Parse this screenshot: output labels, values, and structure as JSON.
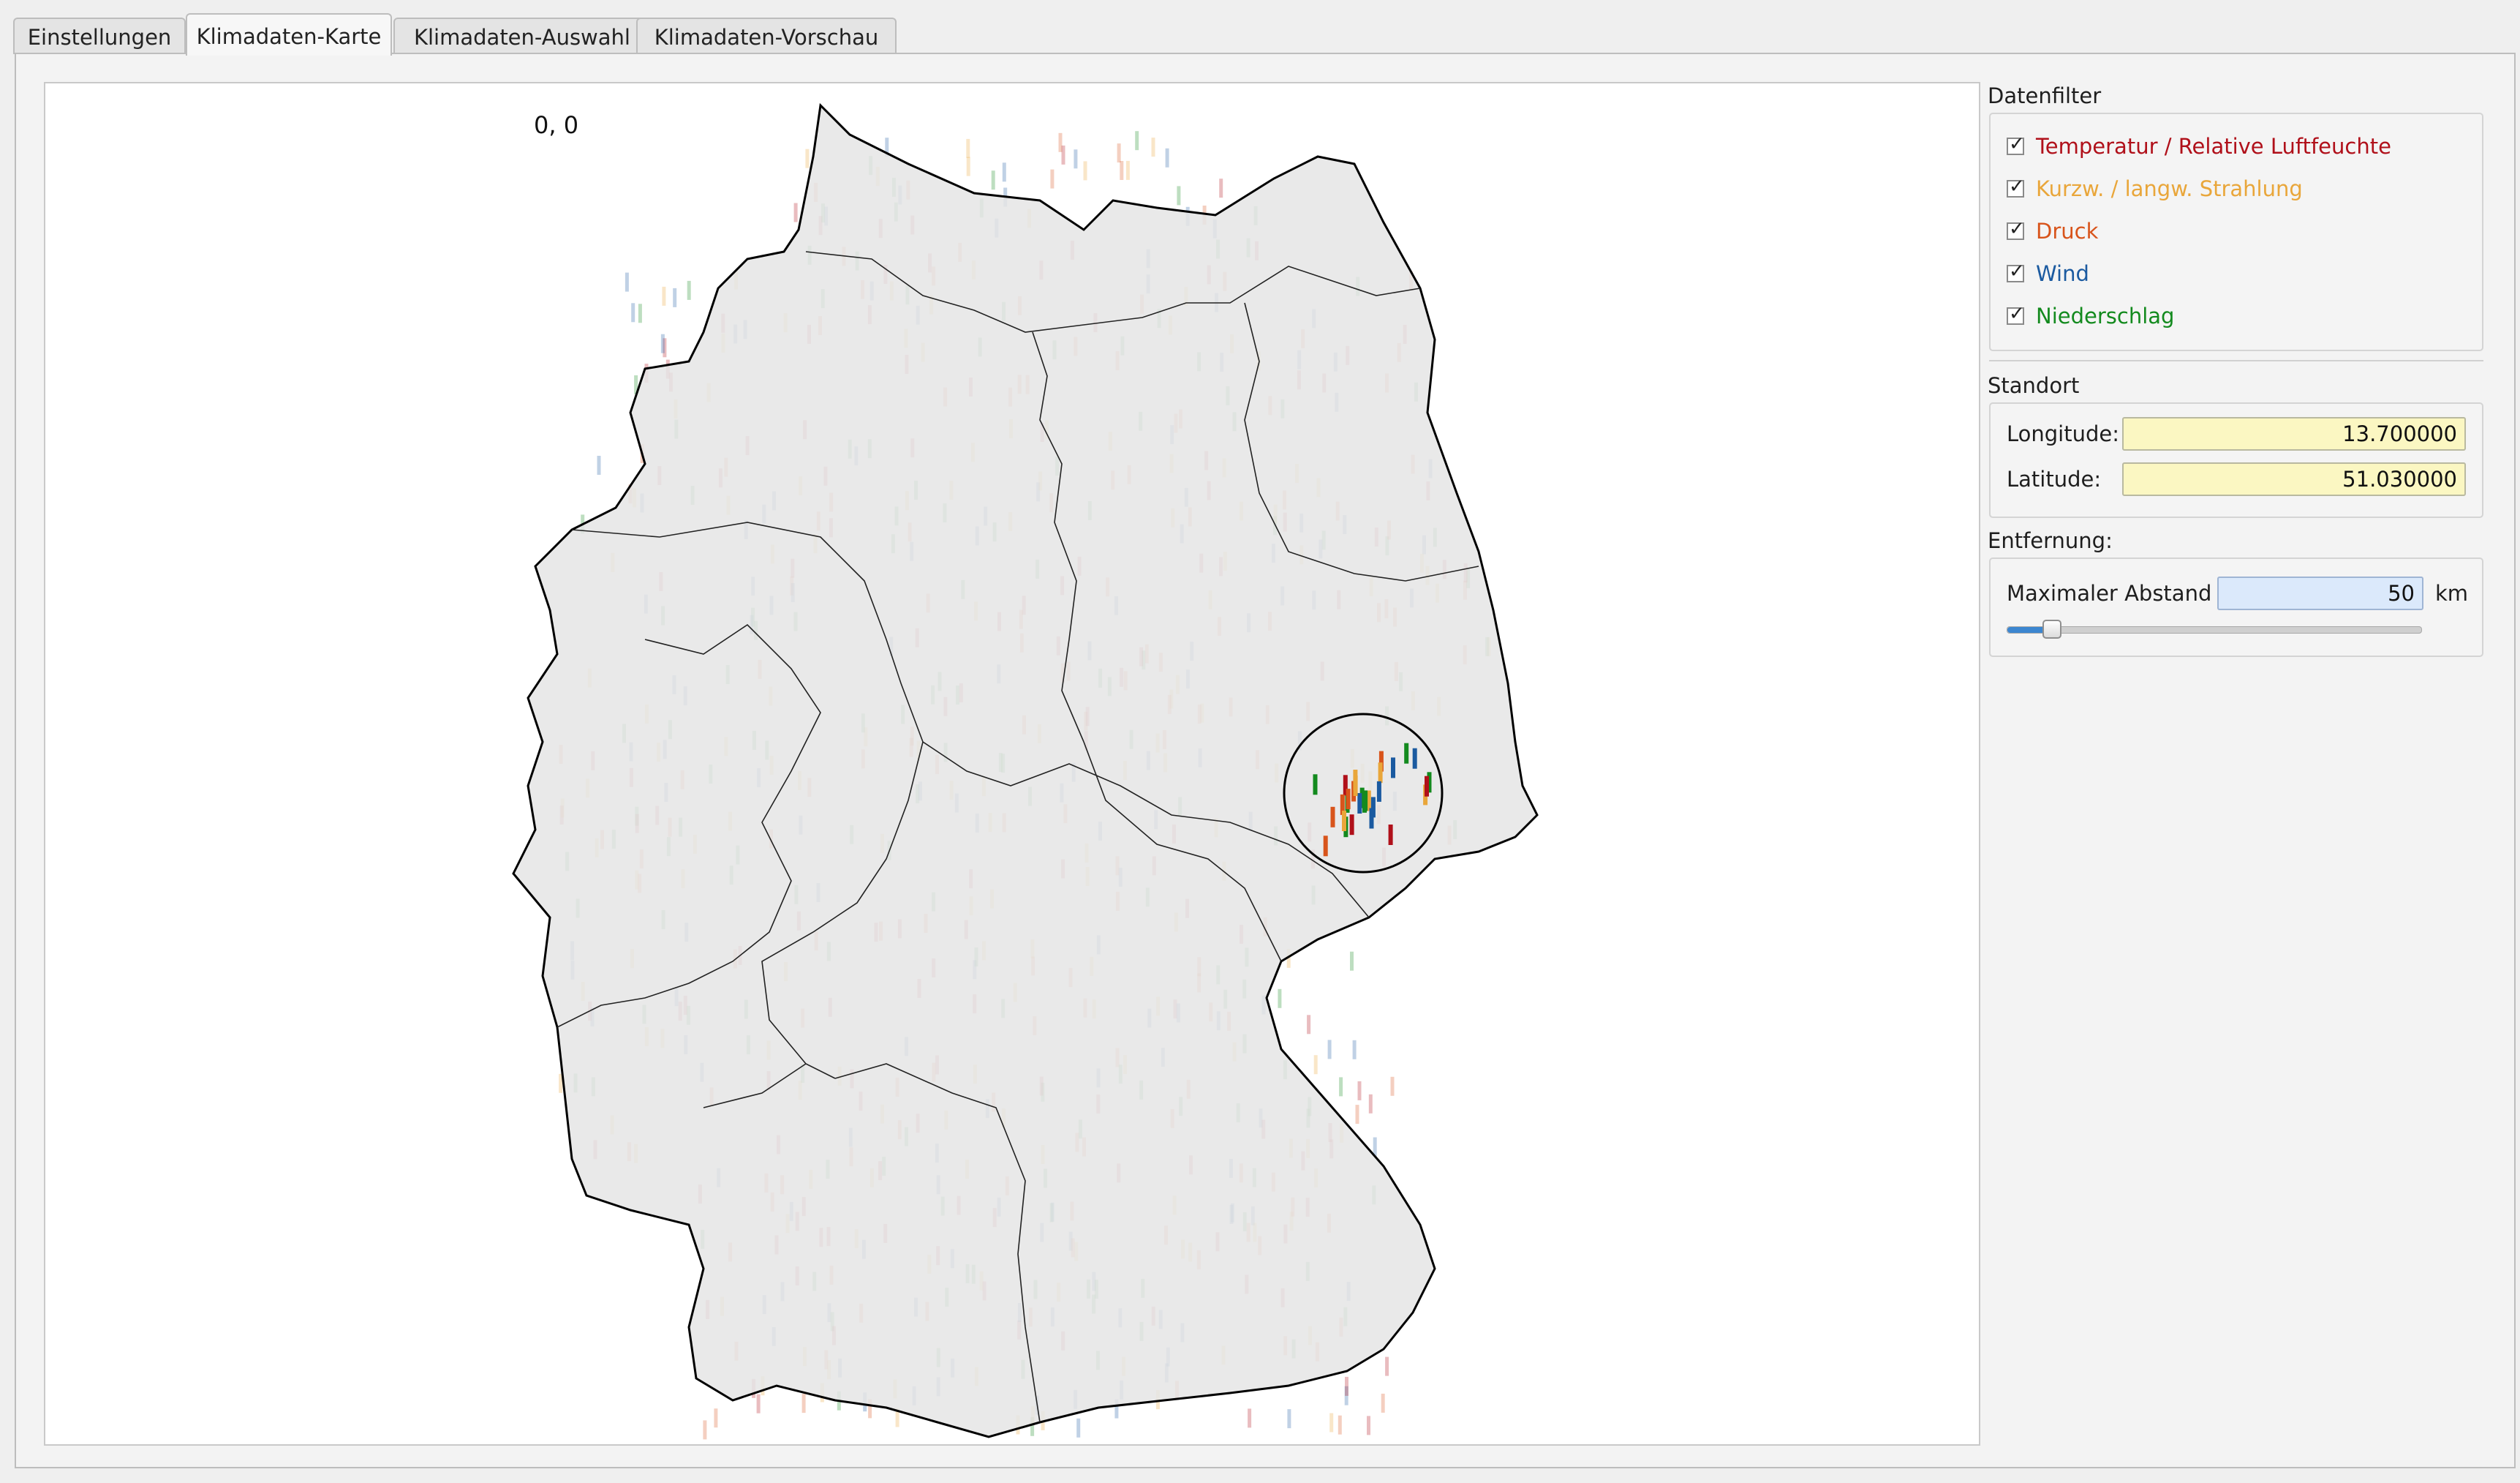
{
  "tabs": [
    {
      "label": "Einstellungen",
      "active": false
    },
    {
      "label": "Klimadaten-Karte",
      "active": true
    },
    {
      "label": "Klimadaten-Auswahl",
      "active": false
    },
    {
      "label": "Klimadaten-Vorschau",
      "active": false
    }
  ],
  "map": {
    "coord_readout": "0, 0",
    "selected_longitude": 13.7,
    "selected_latitude": 51.03,
    "radius_km": 50
  },
  "sidebar": {
    "datenfilter": {
      "title": "Datenfilter",
      "items": [
        {
          "label": "Temperatur / Relative Luftfeuchte",
          "checked": true,
          "color": "#b0101a"
        },
        {
          "label": "Kurzw. / langw. Strahlung",
          "checked": true,
          "color": "#e9a63a"
        },
        {
          "label": "Druck",
          "checked": true,
          "color": "#d8541b"
        },
        {
          "label": "Wind",
          "checked": true,
          "color": "#1b5aa0"
        },
        {
          "label": "Niederschlag",
          "checked": true,
          "color": "#138a1e"
        }
      ]
    },
    "standort": {
      "title": "Standort",
      "longitude_label": "Longitude:",
      "longitude_value": "13.700000",
      "latitude_label": "Latitude:",
      "latitude_value": "51.030000"
    },
    "entfernung": {
      "title": "Entfernung:",
      "max_label": "Maximaler Abstand",
      "max_value": "50",
      "unit": "km",
      "slider_fraction": 0.11
    }
  }
}
